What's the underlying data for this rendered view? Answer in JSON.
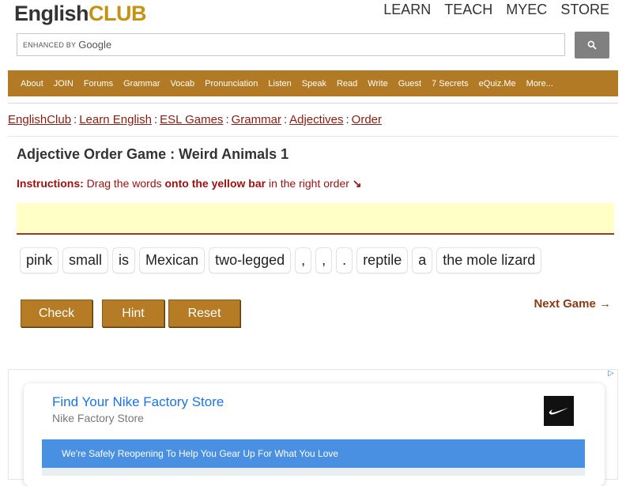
{
  "logo": {
    "part1": "English",
    "part2": "CLUB"
  },
  "topnav": [
    "LEARN",
    "TEACH",
    "MYEC",
    "STORE"
  ],
  "search": {
    "enhanced": "ENHANCED BY",
    "provider": "Google",
    "icon": "search-icon"
  },
  "menu": [
    "About",
    "JOIN",
    "Forums",
    "Grammar",
    "Vocab",
    "Pronunciation",
    "Listen",
    "Speak",
    "Read",
    "Write",
    "Guest",
    "7 Secrets",
    "eQuiz.Me",
    "More..."
  ],
  "breadcrumb": [
    "EnglishClub",
    "Learn English",
    "ESL Games",
    "Grammar",
    "Adjectives",
    "Order"
  ],
  "game": {
    "title": "Adjective Order Game : Weird Animals 1",
    "instr_label": "Instructions:",
    "instr_text1": " Drag the words ",
    "instr_bold": "onto the yellow bar",
    "instr_text2": " in the right order ",
    "instr_arrow": "↘",
    "words": [
      "pink",
      "small",
      "is",
      "Mexican",
      "two-legged",
      ",",
      ",",
      ".",
      "reptile",
      "a",
      "the mole lizard"
    ],
    "check": "Check",
    "hint": "Hint",
    "reset": "Reset",
    "next": "Next Game →"
  },
  "ad": {
    "title": "Find Your Nike Factory Store",
    "subtitle": "Nike Factory Store",
    "banner": "We're Safely Reopening To Help You Gear Up For What You Love",
    "choices": "▷"
  },
  "colors": {
    "brand": "#b27a24",
    "link": "#8b1c0e",
    "instr": "#a01010",
    "drop": "#ffffc6"
  }
}
